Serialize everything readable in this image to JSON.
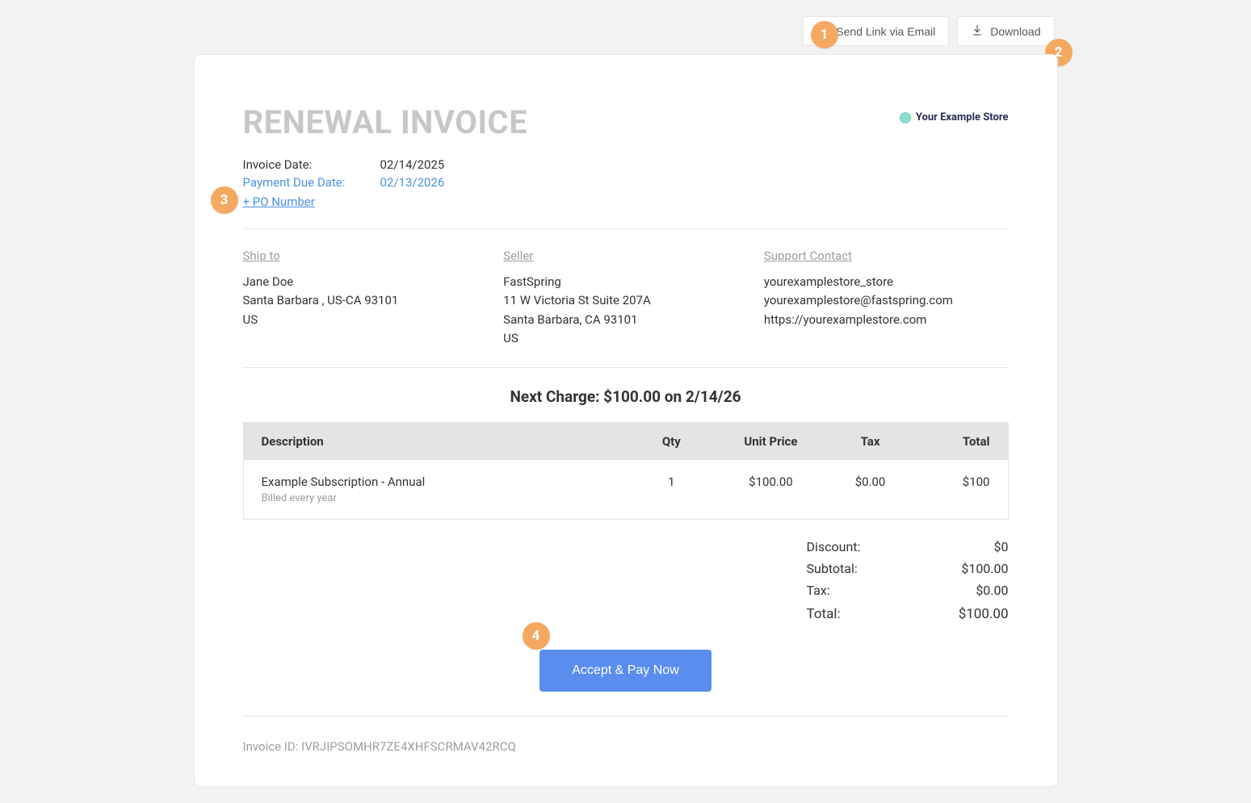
{
  "toolbar": {
    "send_email": "Send Link via Email",
    "download": "Download"
  },
  "header": {
    "title": "RENEWAL INVOICE",
    "store_name": "Your Example Store"
  },
  "meta": {
    "invoice_date_label": "Invoice Date:",
    "invoice_date": "02/14/2025",
    "due_label": "Payment Due Date:",
    "due_date": "02/13/2026",
    "po_link": "+ PO Number"
  },
  "ship_to": {
    "heading": "Ship to",
    "name": "Jane Doe",
    "city_line": "Santa Barbara , US-CA 93101",
    "country": "US"
  },
  "seller": {
    "heading": "Seller",
    "name": "FastSpring",
    "address1": "11 W Victoria St Suite 207A",
    "city_line": "Santa Barbara, CA 93101",
    "country": "US"
  },
  "support": {
    "heading": "Support Contact",
    "store_id": "yourexamplestore_store",
    "email": "yourexamplestore@fastspring.com",
    "url": "https://yourexamplestore.com"
  },
  "next_charge": "Next Charge: $100.00 on 2/14/26",
  "table": {
    "headers": {
      "description": "Description",
      "qty": "Qty",
      "unit_price": "Unit Price",
      "tax": "Tax",
      "total": "Total"
    },
    "rows": [
      {
        "name": "Example Subscription - Annual",
        "sub": "Billed every year",
        "qty": "1",
        "unit_price": "$100.00",
        "tax": "$0.00",
        "total": "$100"
      }
    ]
  },
  "totals": {
    "discount_label": "Discount:",
    "discount_value": "$0",
    "subtotal_label": "Subtotal:",
    "subtotal_value": "$100.00",
    "tax_label": "Tax:",
    "tax_value": "$0.00",
    "total_label": "Total:",
    "total_value": "$100.00"
  },
  "pay_button": "Accept & Pay Now",
  "invoice_id_label": "Invoice ID:",
  "invoice_id": "IVRJIPSOMHR7ZE4XHFSCRMAV42RCQ",
  "badges": {
    "b1": "1",
    "b2": "2",
    "b3": "3",
    "b4": "4"
  }
}
